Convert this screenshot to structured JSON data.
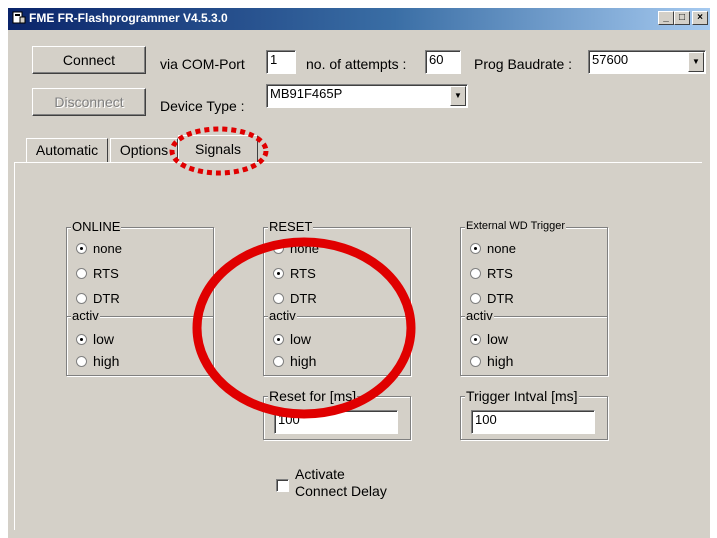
{
  "window": {
    "title": "FME FR-Flashprogrammer V4.5.3.0",
    "controls": [
      "_",
      "□",
      "×"
    ]
  },
  "toolbar": {
    "connect_label": "Connect",
    "disconnect_label": "Disconnect",
    "via_com_label": "via COM-Port",
    "com_port_value": "1",
    "attempts_label": "no. of attempts :",
    "attempts_value": "60",
    "baud_label": "Prog Baudrate :",
    "baud_value": "57600",
    "device_label": "Device Type :",
    "device_value": "MB91F465P"
  },
  "tabs": [
    {
      "label": "Automatic"
    },
    {
      "label": "Options"
    },
    {
      "label": "Signals",
      "active": true
    }
  ],
  "signals": {
    "online": {
      "title": "ONLINE",
      "options": [
        "none",
        "RTS",
        "DTR"
      ],
      "selected": "none",
      "activ_title": "activ",
      "activ_options": [
        "low",
        "high"
      ],
      "activ_selected": "low"
    },
    "reset": {
      "title": "RESET",
      "options": [
        "none",
        "RTS",
        "DTR"
      ],
      "selected": "RTS",
      "activ_title": "activ",
      "activ_options": [
        "low",
        "high"
      ],
      "activ_selected": "low",
      "time_title": "Reset for [ms]",
      "time_value": "100"
    },
    "wd": {
      "title": "External WD Trigger",
      "options": [
        "none",
        "RTS",
        "DTR"
      ],
      "selected": "none",
      "activ_title": "activ",
      "activ_options": [
        "low",
        "high"
      ],
      "activ_selected": "low",
      "time_title": "Trigger Intval [ms]",
      "time_value": "100"
    },
    "connect_delay_label_1": "Activate",
    "connect_delay_label_2": "Connect Delay",
    "connect_delay_checked": false
  },
  "annotation_color": "#e00000"
}
